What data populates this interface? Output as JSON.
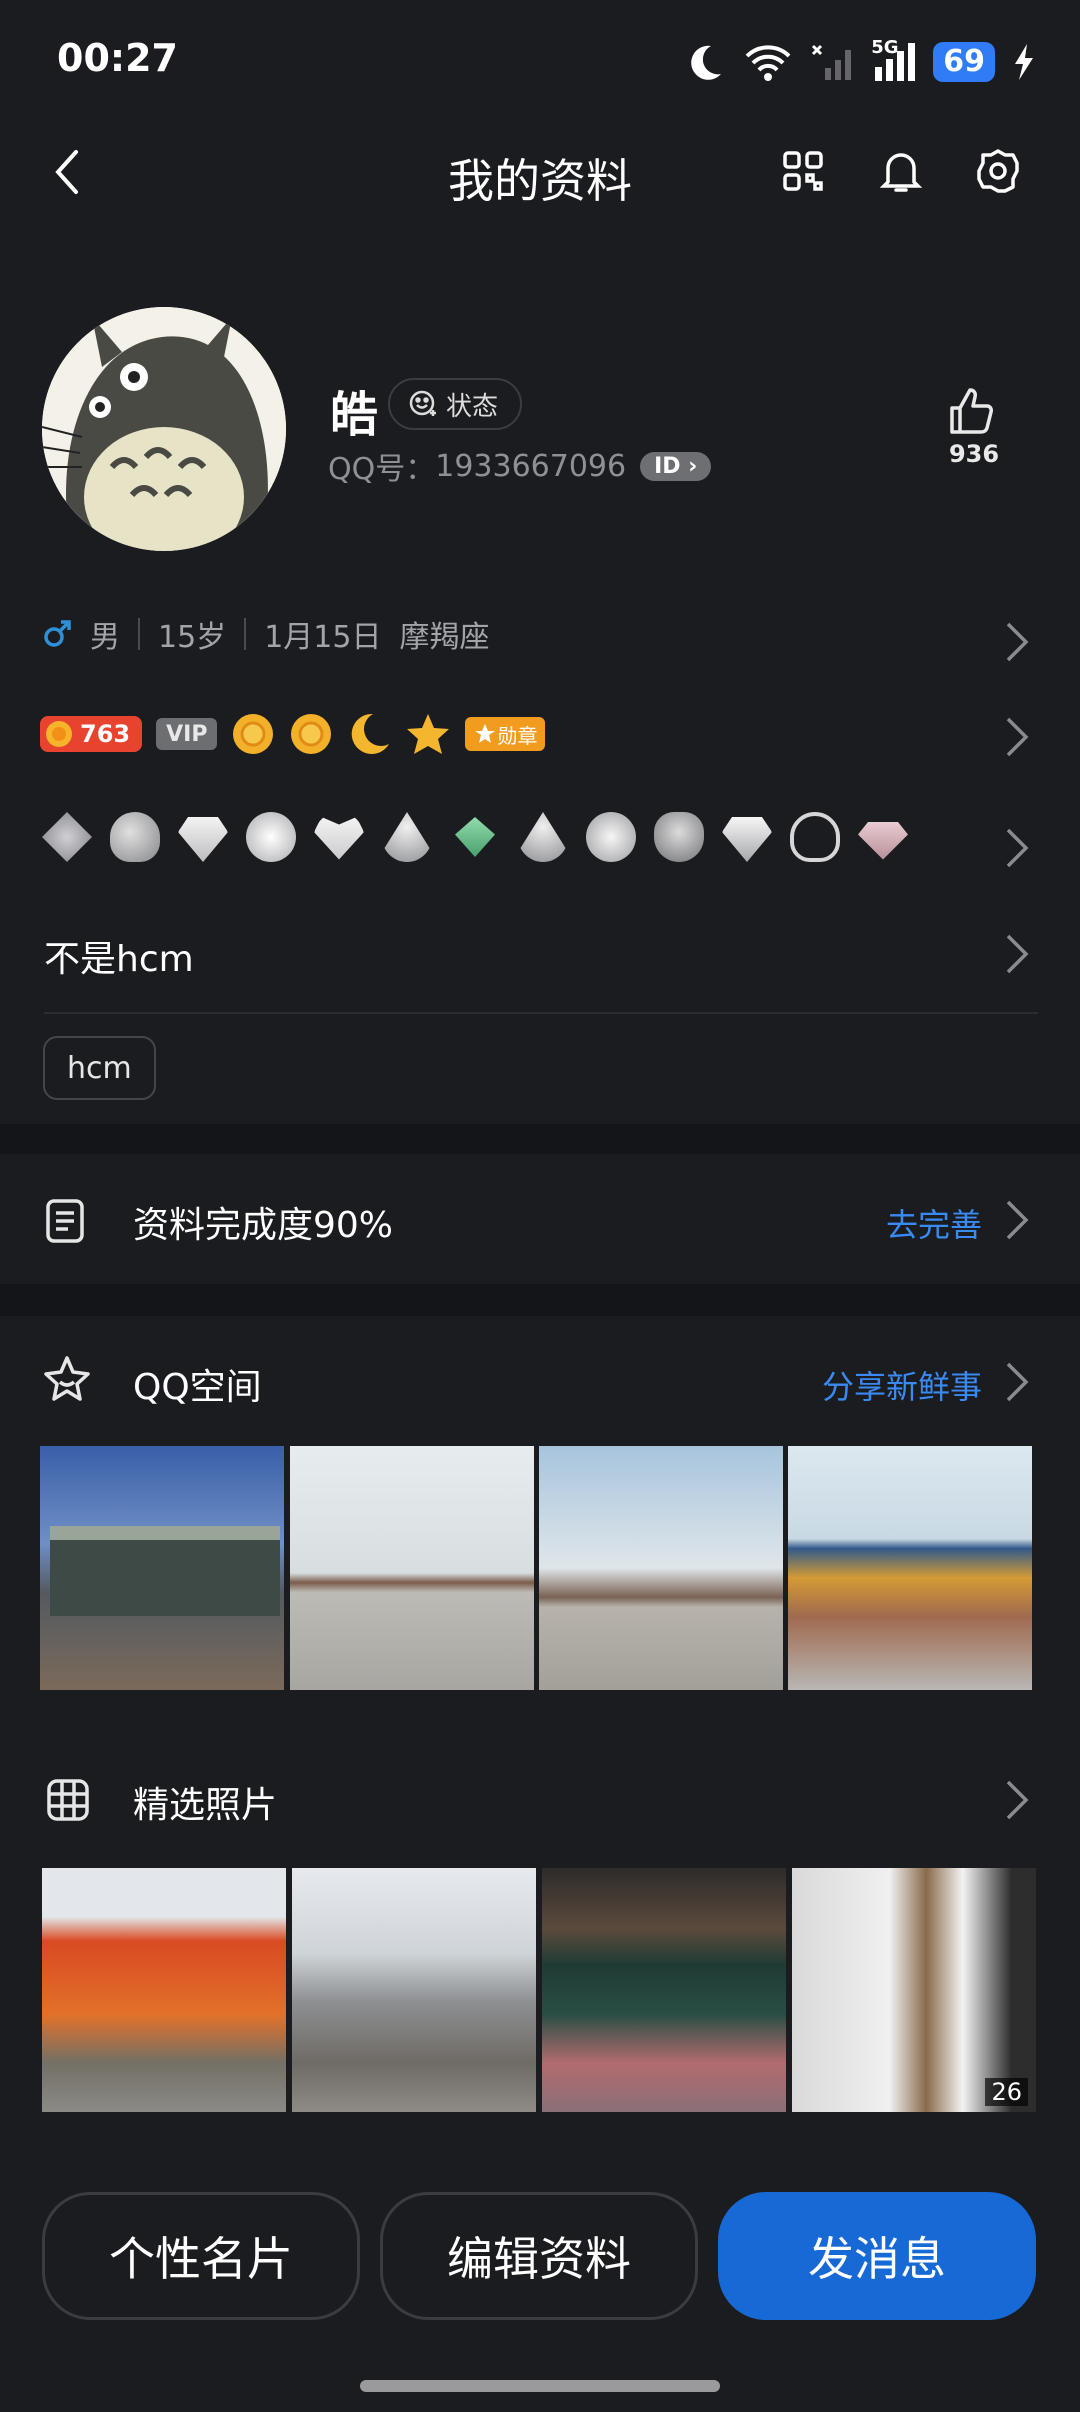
{
  "status_bar": {
    "time": "00:27",
    "network": "5G",
    "battery": "69",
    "icons": [
      "moon-icon",
      "wifi-icon",
      "signal-off-icon",
      "signal-5g-icon",
      "battery-icon",
      "charging-icon"
    ]
  },
  "header": {
    "title": "我的资料",
    "icons": [
      "back-icon",
      "qr-code-icon",
      "bell-icon",
      "gear-icon"
    ]
  },
  "profile": {
    "name": "皓",
    "status_label": "状态",
    "qq_label": "QQ号：",
    "qq_number": "1933667096",
    "id_badge": "ID",
    "likes": "936"
  },
  "info": {
    "gender": "男",
    "age": "15岁",
    "birthday": "1月15日",
    "zodiac": "摩羯座"
  },
  "badges": {
    "level": "763",
    "vip": "VIP",
    "medal": "勋章"
  },
  "signature": "不是hcm",
  "tags": [
    "hcm"
  ],
  "completion": {
    "label": "资料完成度90%",
    "action": "去完善"
  },
  "qzone": {
    "title": "QQ空间",
    "action": "分享新鲜事"
  },
  "photos": {
    "title": "精选照片",
    "count": "26"
  },
  "buttons": {
    "card": "个性名片",
    "edit": "编辑资料",
    "message": "发消息"
  },
  "colors": {
    "background": "#1b1c1f",
    "accent_blue": "#1769d6",
    "link_blue": "#3a8af4",
    "gender_blue": "#2f8fd8"
  }
}
